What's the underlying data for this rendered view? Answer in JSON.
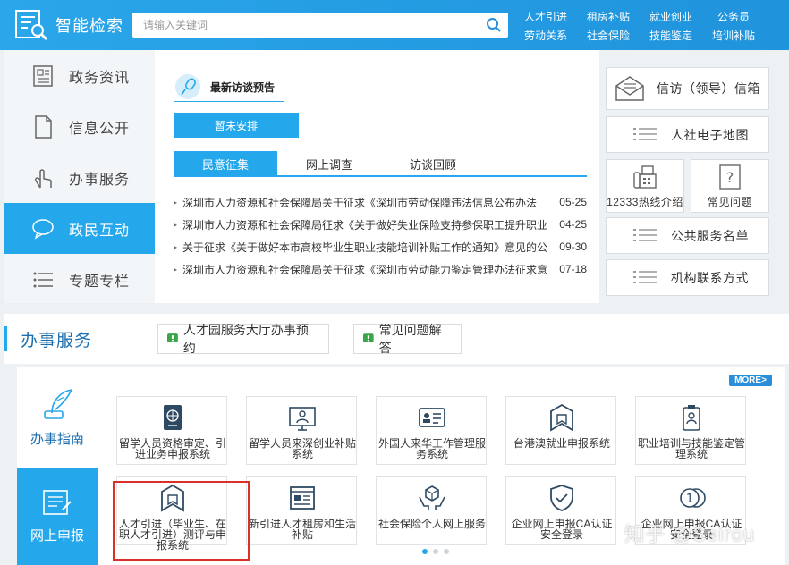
{
  "header": {
    "brand": "智能检索",
    "search_placeholder": "请输入关键词",
    "links_row1": [
      "人才引进",
      "租房补贴",
      "就业创业",
      "公务员"
    ],
    "links_row2": [
      "劳动关系",
      "社会保险",
      "技能鉴定",
      "培训补贴"
    ]
  },
  "sidebar": {
    "items": [
      {
        "label": "政务资讯",
        "icon": "newspaper-icon"
      },
      {
        "label": "信息公开",
        "icon": "document-icon"
      },
      {
        "label": "办事服务",
        "icon": "hand-pointer-icon"
      },
      {
        "label": "政民互动",
        "icon": "speech-bubble-icon",
        "active": true
      },
      {
        "label": "专题专栏",
        "icon": "list-icon"
      }
    ]
  },
  "interview": {
    "title": "最新访谈预告",
    "pending": "暂未安排"
  },
  "tabs": [
    {
      "label": "民意征集",
      "active": true
    },
    {
      "label": "网上调查"
    },
    {
      "label": "访谈回顾"
    }
  ],
  "news": [
    {
      "title": "深圳市人力资源和社会保障局关于征求《深圳市劳动保障违法信息公布办法",
      "date": "05-25"
    },
    {
      "title": "深圳市人力资源和社会保障局征求《关于做好失业保险支持参保职工提升职业",
      "date": "04-25"
    },
    {
      "title": "关于征求《关于做好本市高校毕业生职业技能培训补贴工作的通知》意见的公",
      "date": "09-30"
    },
    {
      "title": "深圳市人力资源和社会保障局关于征求《深圳市劳动能力鉴定管理办法征求意",
      "date": "07-18"
    }
  ],
  "right_tiles": {
    "mailbox": "信访（领导）信箱",
    "map": "人社电子地图",
    "hotline": "12333热线介绍",
    "faq": "常见问题",
    "services_list": "公共服务名单",
    "contacts": "机构联系方式"
  },
  "service": {
    "title": "办事服务",
    "link1": "人才园服务大厅办事预约",
    "link2": "常见问题解答",
    "guide_tab": "办事指南",
    "apply_tab": "网上申报",
    "more": "MORE>",
    "cards": [
      {
        "label": "留学人员资格审定、引进业务申报系统",
        "icon": "passport-icon"
      },
      {
        "label": "留学人员来深创业补贴系统",
        "icon": "monitor-person-icon"
      },
      {
        "label": "外国人来华工作管理服务系统",
        "icon": "id-card-icon"
      },
      {
        "label": "台港澳就业申报系统",
        "icon": "bookmark-icon"
      },
      {
        "label": "职业培训与技能鉴定管理系统",
        "icon": "badge-icon"
      },
      {
        "label": "人才引进（毕业生、在职人才引进）测评与申报系统",
        "icon": "bookmark-icon"
      },
      {
        "label": "新引进人才租房和生活补贴",
        "icon": "web-page-icon"
      },
      {
        "label": "社会保险个人网上服务",
        "icon": "hands-box-icon"
      },
      {
        "label": "企业网上申报CA认证安全登录",
        "icon": "shield-check-icon"
      },
      {
        "label": "企业网上申报CA认证安全登录",
        "icon": "coins-icon"
      }
    ]
  },
  "watermark": "知乎 @Seirou",
  "colors": {
    "accent": "#25a7ec",
    "header": "#2aa6ea",
    "highlight": "#d9302a"
  }
}
